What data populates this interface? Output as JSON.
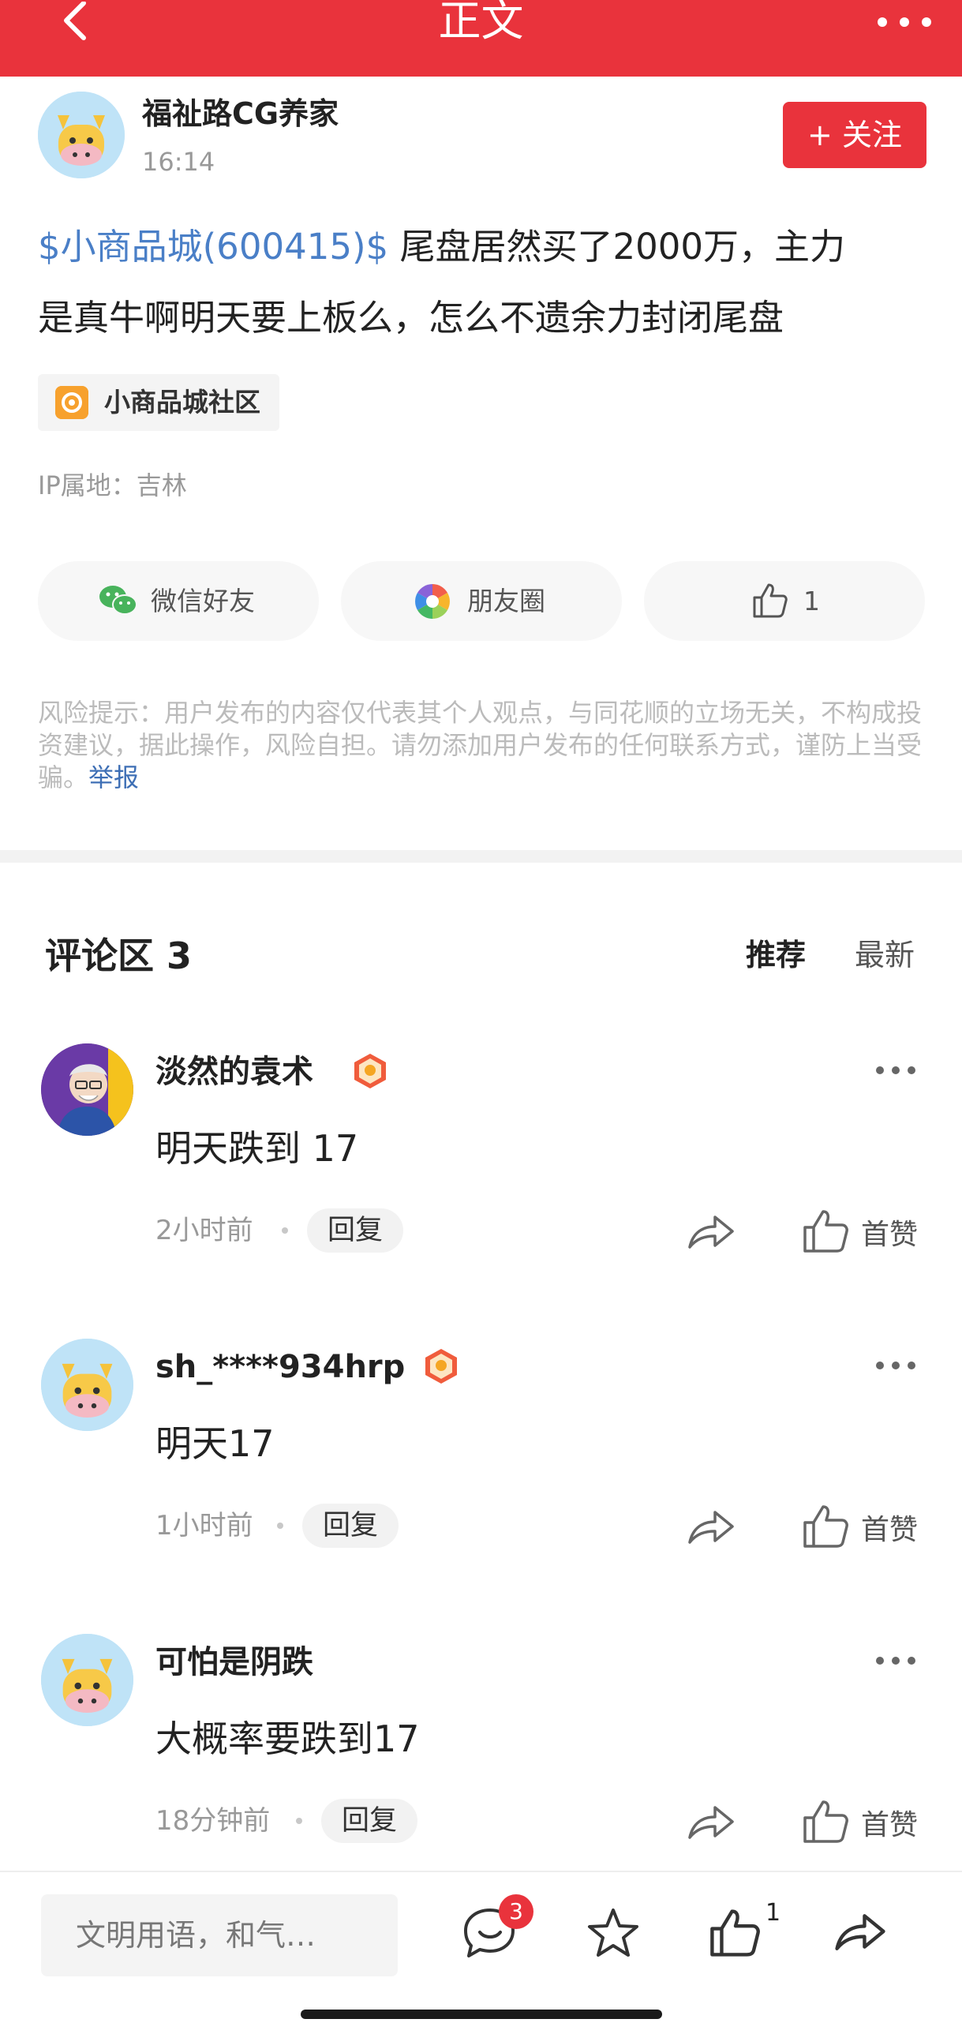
{
  "header": {
    "title": "正文"
  },
  "post": {
    "author": "福祉路CG养家",
    "time": "16:14",
    "follow_label": "+ 关注",
    "stock_tag": "$小商品城(600415)$",
    "text_line1": " 尾盘居然买了2000万，主力",
    "text_line2": "是真牛啊明天要上板么，怎么不遗余力封闭尾盘",
    "community": "小商品城社区",
    "ip": "IP属地：吉林"
  },
  "share": {
    "wechat_label": "微信好友",
    "moments_label": "朋友圈",
    "like_count": "1"
  },
  "risk": {
    "text": "风险提示：用户发布的内容仅代表其个人观点，与同花顺的立场无关，不构成投资建议，据此操作，风险自担。请勿添加用户发布的任何联系方式，谨防上当受骗。",
    "report_label": "举报"
  },
  "comments_section": {
    "title": "评论区 3",
    "sort_recommended": "推荐",
    "sort_latest": "最新"
  },
  "comments": [
    {
      "name": "淡然的袁术",
      "text": "明天跌到 17",
      "time": "2小时前",
      "reply": "回复",
      "like_label": "首赞"
    },
    {
      "name": "sh_****934hrp",
      "text": "明天17",
      "time": "1小时前",
      "reply": "回复",
      "like_label": "首赞"
    },
    {
      "name": "可怕是阴跌",
      "text": "大概率要跌到17",
      "time": "18分钟前",
      "reply": "回复",
      "like_label": "首赞"
    }
  ],
  "bottom_bar": {
    "input_placeholder": "文明用语，和气…",
    "comment_count": "3",
    "like_count": "1"
  },
  "colors": {
    "accent": "#e9333c",
    "link": "#4a7fc7"
  }
}
